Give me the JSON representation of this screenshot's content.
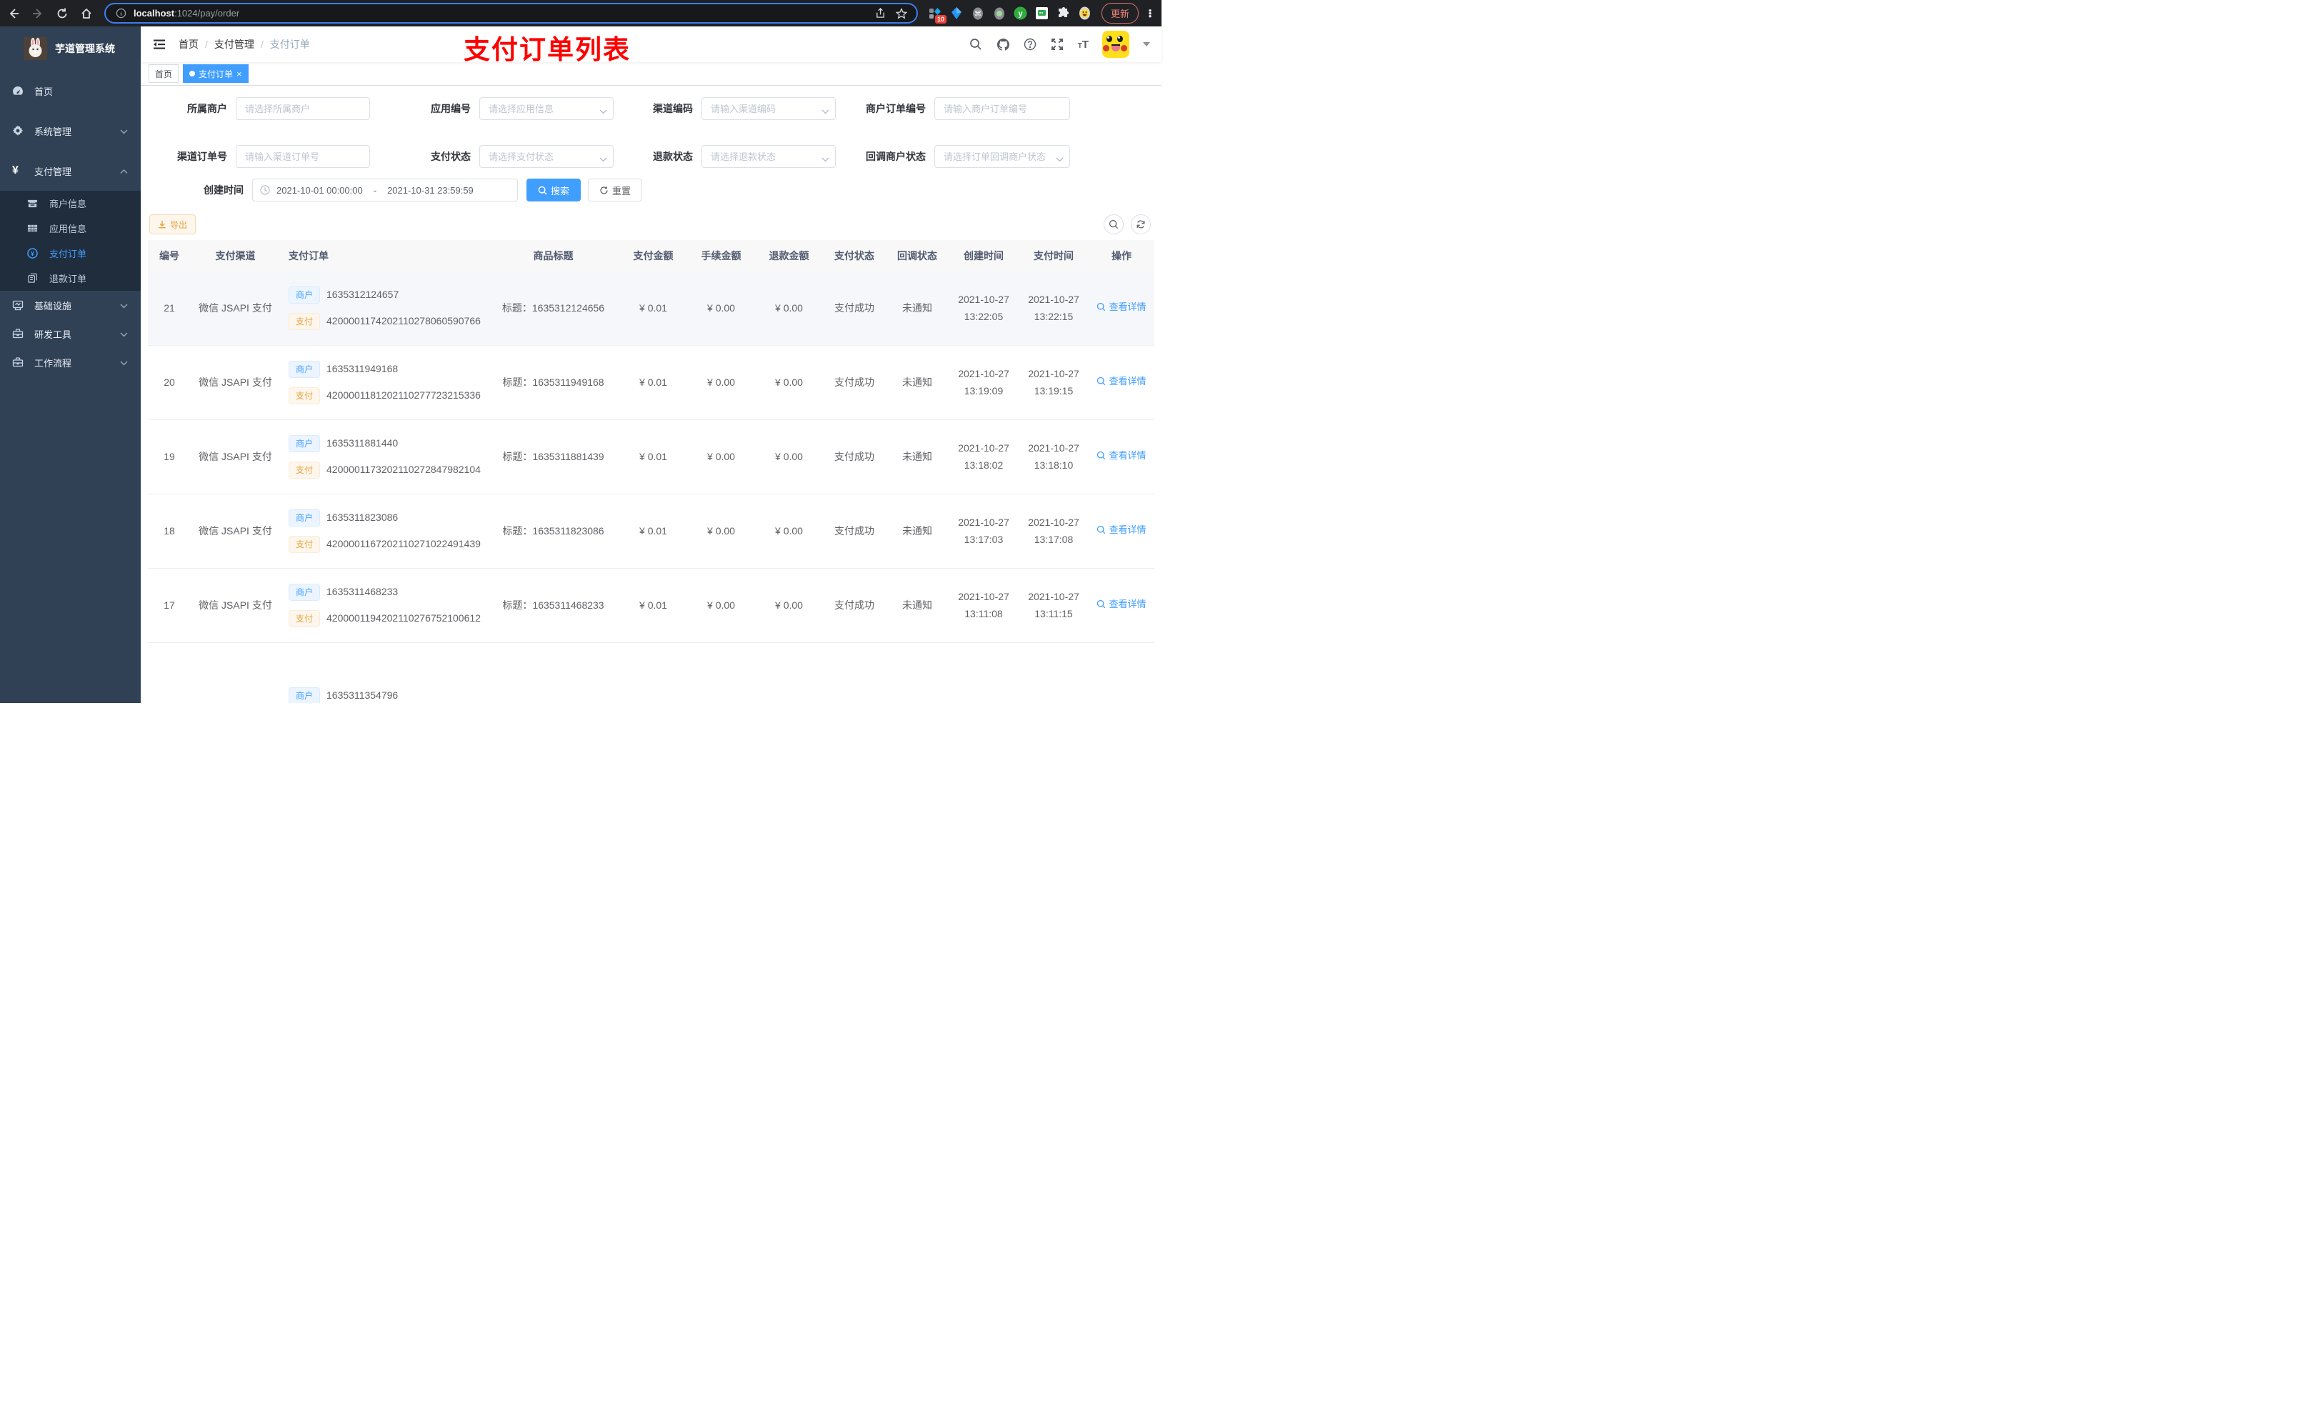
{
  "browser": {
    "url_host": "localhost",
    "url_rest": ":1024/pay/order",
    "extension_badge": "10",
    "update_label": "更新"
  },
  "sidebar": {
    "title": "芋道管理系统",
    "menu": [
      {
        "label": "首页"
      },
      {
        "label": "系统管理"
      },
      {
        "label": "支付管理"
      }
    ],
    "submenu": [
      {
        "label": "商户信息"
      },
      {
        "label": "应用信息"
      },
      {
        "label": "支付订单",
        "active": true
      },
      {
        "label": "退款订单"
      }
    ],
    "menu_bottom": [
      {
        "label": "基础设施"
      },
      {
        "label": "研发工具"
      },
      {
        "label": "工作流程"
      }
    ]
  },
  "navbar": {
    "breadcrumb": [
      "首页",
      "支付管理",
      "支付订单"
    ]
  },
  "annotation": "支付订单列表",
  "tags": [
    {
      "label": "首页"
    },
    {
      "label": "支付订单"
    }
  ],
  "filters": {
    "row1": [
      {
        "label": "所属商户",
        "placeholder": "请选择所属商户"
      },
      {
        "label": "应用编号",
        "placeholder": "请选择应用信息"
      },
      {
        "label": "渠道编码",
        "placeholder": "请输入渠道编码"
      },
      {
        "label": "商户订单编号",
        "placeholder": "请输入商户订单编号"
      }
    ],
    "row2": [
      {
        "label": "渠道订单号",
        "placeholder": "请输入渠道订单号"
      },
      {
        "label": "支付状态",
        "placeholder": "请选择支付状态"
      },
      {
        "label": "退款状态",
        "placeholder": "请选择退款状态"
      },
      {
        "label": "回调商户状态",
        "placeholder": "请选择订单回调商户状态"
      }
    ],
    "date": {
      "label": "创建时间",
      "start": "2021-10-01 00:00:00",
      "sep": "-",
      "end": "2021-10-31 23:59:59"
    },
    "search_label": "搜索",
    "reset_label": "重置"
  },
  "toolbar": {
    "export_label": "导出"
  },
  "table": {
    "columns": [
      "编号",
      "支付渠道",
      "支付订单",
      "商品标题",
      "支付金额",
      "手续金额",
      "退款金额",
      "支付状态",
      "回调状态",
      "创建时间",
      "支付时间",
      "操作"
    ],
    "tag_merchant": "商户",
    "tag_pay": "支付",
    "rows": [
      {
        "id": "21",
        "channel": "微信 JSAPI 支付",
        "merchant_no": "1635312124657",
        "pay_no": "4200001174202110278060590766",
        "title": "标题：1635312124656",
        "amount": "¥ 0.01",
        "fee": "¥ 0.00",
        "refund": "¥ 0.00",
        "pay_status": "支付成功",
        "notify_status": "未通知",
        "create_time": "2021-10-27 13:22:05",
        "pay_time": "2021-10-27 13:22:15",
        "action": "查看详情",
        "hover": true
      },
      {
        "id": "20",
        "channel": "微信 JSAPI 支付",
        "merchant_no": "1635311949168",
        "pay_no": "4200001181202110277723215336",
        "title": "标题：1635311949168",
        "amount": "¥ 0.01",
        "fee": "¥ 0.00",
        "refund": "¥ 0.00",
        "pay_status": "支付成功",
        "notify_status": "未通知",
        "create_time": "2021-10-27 13:19:09",
        "pay_time": "2021-10-27 13:19:15",
        "action": "查看详情"
      },
      {
        "id": "19",
        "channel": "微信 JSAPI 支付",
        "merchant_no": "1635311881440",
        "pay_no": "4200001173202110272847982104",
        "title": "标题：1635311881439",
        "amount": "¥ 0.01",
        "fee": "¥ 0.00",
        "refund": "¥ 0.00",
        "pay_status": "支付成功",
        "notify_status": "未通知",
        "create_time": "2021-10-27 13:18:02",
        "pay_time": "2021-10-27 13:18:10",
        "action": "查看详情"
      },
      {
        "id": "18",
        "channel": "微信 JSAPI 支付",
        "merchant_no": "1635311823086",
        "pay_no": "4200001167202110271022491439",
        "title": "标题：1635311823086",
        "amount": "¥ 0.01",
        "fee": "¥ 0.00",
        "refund": "¥ 0.00",
        "pay_status": "支付成功",
        "notify_status": "未通知",
        "create_time": "2021-10-27 13:17:03",
        "pay_time": "2021-10-27 13:17:08",
        "action": "查看详情"
      },
      {
        "id": "17",
        "channel": "微信 JSAPI 支付",
        "merchant_no": "1635311468233",
        "pay_no": "4200001194202110276752100612",
        "title": "标题：1635311468233",
        "amount": "¥ 0.01",
        "fee": "¥ 0.00",
        "refund": "¥ 0.00",
        "pay_status": "支付成功",
        "notify_status": "未通知",
        "create_time": "2021-10-27 13:11:08",
        "pay_time": "2021-10-27 13:11:15",
        "action": "查看详情"
      },
      {
        "id": "",
        "channel": "",
        "merchant_no": "1635311354796",
        "pay_no": "",
        "title": "",
        "amount": "",
        "fee": "",
        "refund": "",
        "pay_status": "",
        "notify_status": "",
        "create_time": "",
        "pay_time": "",
        "action": "",
        "partial": true
      }
    ]
  },
  "colors": {
    "accent": "#409eff",
    "sidebar_bg": "#304156",
    "submenu_bg": "#1f2d3d",
    "warning": "#e6a23c",
    "annotation_red": "#fd0000",
    "tag_active_bg": "#409eff"
  },
  "icon_names": [
    "back-icon",
    "forward-icon",
    "reload-icon",
    "home-icon",
    "info-icon",
    "share-icon",
    "star-icon",
    "extension-icons",
    "kebab-menu-icon",
    "dashboard-icon",
    "gear-icon",
    "yen-icon",
    "store-icon",
    "grid-icon",
    "yen-circle-icon",
    "documents-icon",
    "monitor-icon",
    "toolbox-icon",
    "briefcase-icon",
    "hamburger-icon",
    "search-icon",
    "github-icon",
    "question-icon",
    "fullscreen-icon",
    "font-size-icon",
    "avatar",
    "clock-icon",
    "download-icon",
    "refresh-icon",
    "magnifier-icon",
    "chevron-down-icon",
    "chevron-up-icon"
  ]
}
